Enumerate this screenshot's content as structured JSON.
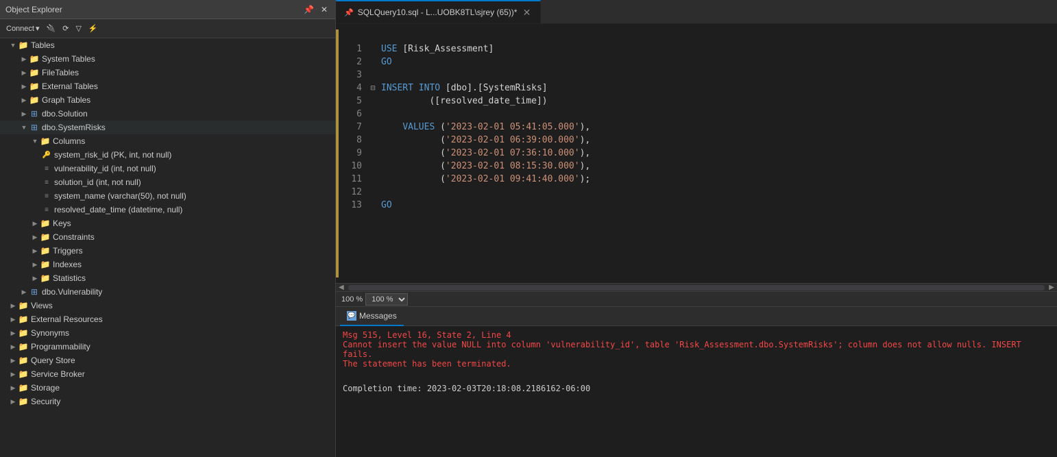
{
  "objectExplorer": {
    "title": "Object Explorer",
    "headerIcons": [
      "📌",
      "✕"
    ],
    "toolbar": {
      "connectLabel": "Connect",
      "connectDropdown": "▼"
    },
    "tree": [
      {
        "level": 1,
        "type": "folder",
        "expanded": true,
        "label": "Tables",
        "icon": "folder-yellow"
      },
      {
        "level": 2,
        "type": "folder",
        "expanded": false,
        "label": "System Tables",
        "icon": "folder-yellow"
      },
      {
        "level": 2,
        "type": "folder",
        "expanded": false,
        "label": "FileTables",
        "icon": "folder-yellow"
      },
      {
        "level": 2,
        "type": "folder",
        "expanded": false,
        "label": "External Tables",
        "icon": "folder-yellow"
      },
      {
        "level": 2,
        "type": "folder",
        "expanded": false,
        "label": "Graph Tables",
        "icon": "folder-yellow"
      },
      {
        "level": 2,
        "type": "table",
        "expanded": false,
        "label": "dbo.Solution",
        "icon": "table"
      },
      {
        "level": 2,
        "type": "table",
        "expanded": true,
        "label": "dbo.SystemRisks",
        "icon": "table"
      },
      {
        "level": 3,
        "type": "folder",
        "expanded": true,
        "label": "Columns",
        "icon": "folder-yellow"
      },
      {
        "level": 4,
        "type": "pk-col",
        "label": "system_risk_id (PK, int, not null)"
      },
      {
        "level": 4,
        "type": "col",
        "label": "vulnerability_id (int, not null)"
      },
      {
        "level": 4,
        "type": "col",
        "label": "solution_id (int, not null)"
      },
      {
        "level": 4,
        "type": "col",
        "label": "system_name (varchar(50), not null)"
      },
      {
        "level": 4,
        "type": "col",
        "label": "resolved_date_time (datetime, null)"
      },
      {
        "level": 3,
        "type": "folder",
        "expanded": false,
        "label": "Keys",
        "icon": "folder-yellow"
      },
      {
        "level": 3,
        "type": "folder",
        "expanded": false,
        "label": "Constraints",
        "icon": "folder-yellow"
      },
      {
        "level": 3,
        "type": "folder",
        "expanded": false,
        "label": "Triggers",
        "icon": "folder-yellow"
      },
      {
        "level": 3,
        "type": "folder",
        "expanded": false,
        "label": "Indexes",
        "icon": "folder-yellow"
      },
      {
        "level": 3,
        "type": "folder",
        "expanded": false,
        "label": "Statistics",
        "icon": "folder-yellow"
      },
      {
        "level": 2,
        "type": "table",
        "expanded": false,
        "label": "dbo.Vulnerability",
        "icon": "table"
      },
      {
        "level": 1,
        "type": "folder",
        "expanded": false,
        "label": "Views",
        "icon": "folder-yellow"
      },
      {
        "level": 1,
        "type": "folder",
        "expanded": false,
        "label": "External Resources",
        "icon": "folder-yellow"
      },
      {
        "level": 1,
        "type": "folder",
        "expanded": false,
        "label": "Synonyms",
        "icon": "folder-yellow"
      },
      {
        "level": 1,
        "type": "folder",
        "expanded": false,
        "label": "Programmability",
        "icon": "folder-yellow"
      },
      {
        "level": 1,
        "type": "folder",
        "expanded": false,
        "label": "Query Store",
        "icon": "folder-yellow"
      },
      {
        "level": 1,
        "type": "folder",
        "expanded": false,
        "label": "Service Broker",
        "icon": "folder-yellow"
      },
      {
        "level": 1,
        "type": "folder",
        "expanded": false,
        "label": "Storage",
        "icon": "folder-yellow"
      },
      {
        "level": 1,
        "type": "folder",
        "expanded": false,
        "label": "Security",
        "icon": "folder-yellow"
      }
    ]
  },
  "editor": {
    "tab": {
      "label": "SQLQuery10.sql - L...UOBK8TL\\sjrey (65))*",
      "pinned": false,
      "modified": true
    },
    "lines": [
      {
        "num": "",
        "content": "",
        "fold": ""
      },
      {
        "num": "1",
        "content": "<kw>USE</kw> [Risk_Assessment]",
        "fold": ""
      },
      {
        "num": "2",
        "content": "<kw>GO</kw>",
        "fold": ""
      },
      {
        "num": "3",
        "content": "",
        "fold": ""
      },
      {
        "num": "4",
        "content": "<kw>INSERT INTO</kw> [dbo].[SystemRisks]",
        "fold": "⊟"
      },
      {
        "num": "5",
        "content": "         ([resolved_date_time])",
        "fold": ""
      },
      {
        "num": "6",
        "content": "",
        "fold": ""
      },
      {
        "num": "7",
        "content": "    <kw2>VALUES</kw2> (<str>'2023-02-01 05:41:05.000'</str>),",
        "fold": ""
      },
      {
        "num": "8",
        "content": "           (<str>'2023-02-01 06:39:00.000'</str>),",
        "fold": ""
      },
      {
        "num": "9",
        "content": "           (<str>'2023-02-01 07:36:10.000'</str>),",
        "fold": ""
      },
      {
        "num": "10",
        "content": "           (<str>'2023-02-01 08:15:30.000'</str>),",
        "fold": ""
      },
      {
        "num": "11",
        "content": "           (<str>'2023-02-01 09:41:40.000'</str>);",
        "fold": ""
      },
      {
        "num": "12",
        "content": "",
        "fold": ""
      },
      {
        "num": "13",
        "content": "<kw>GO</kw>",
        "fold": ""
      }
    ],
    "zoomLevel": "100 %"
  },
  "messages": {
    "tab": "Messages",
    "errorLine1": "Msg 515, Level 16, State 2, Line 4",
    "errorLine2": "Cannot insert the value NULL into column 'vulnerability_id', table 'Risk_Assessment.dbo.SystemRisks'; column does not allow nulls. INSERT fails.",
    "errorLine3": "The statement has been terminated.",
    "completionLine": "Completion time: 2023-02-03T20:18:08.2186162-06:00"
  }
}
